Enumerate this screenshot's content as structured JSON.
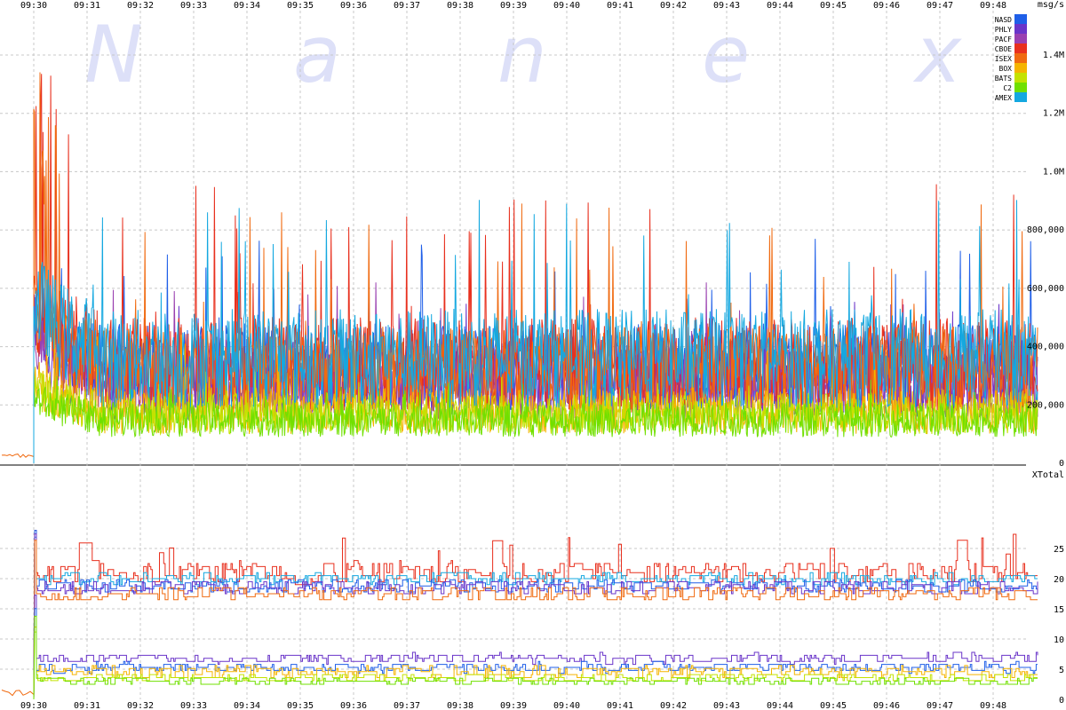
{
  "watermark": [
    "N",
    "a",
    "n",
    "e",
    "x"
  ],
  "chart_data": [
    {
      "type": "line",
      "title": "",
      "xlabel": "",
      "ylabel": "msg/s",
      "x_ticks": [
        "09:30",
        "09:31",
        "09:32",
        "09:33",
        "09:34",
        "09:35",
        "09:36",
        "09:37",
        "09:38",
        "09:39",
        "09:40",
        "09:41",
        "09:42",
        "09:43",
        "09:44",
        "09:45",
        "09:46",
        "09:47",
        "09:48"
      ],
      "y_ticks": [
        0,
        200000,
        400000,
        600000,
        800000,
        1000000,
        1200000,
        1400000
      ],
      "y_tick_labels": [
        "0",
        "200,000",
        "400,000",
        "600,000",
        "800,000",
        "1.0M",
        "1.2M",
        "1.4M"
      ],
      "ylim": [
        0,
        1500000
      ],
      "xlim": [
        "09:30",
        "09:48:50"
      ],
      "grid": true,
      "legend_position": "top-right",
      "series": [
        {
          "name": "NASD",
          "color": "#1f5fe8",
          "typical": 330000,
          "spread": 150000,
          "peak": 1150000
        },
        {
          "name": "PHLY",
          "color": "#6a35c9",
          "typical": 270000,
          "spread": 120000,
          "peak": 800000
        },
        {
          "name": "PACF",
          "color": "#9a40b0",
          "typical": 300000,
          "spread": 130000,
          "peak": 900000
        },
        {
          "name": "CBOE",
          "color": "#e8301e",
          "typical": 340000,
          "spread": 160000,
          "peak": 1470000
        },
        {
          "name": "ISEX",
          "color": "#f06a10",
          "typical": 320000,
          "spread": 150000,
          "peak": 1360000
        },
        {
          "name": "BOX",
          "color": "#f5b400",
          "typical": 180000,
          "spread": 80000,
          "peak": 700000
        },
        {
          "name": "BATS",
          "color": "#c4e200",
          "typical": 170000,
          "spread": 70000,
          "peak": 450000
        },
        {
          "name": "C2",
          "color": "#70e000",
          "typical": 150000,
          "spread": 60000,
          "peak": 400000
        },
        {
          "name": "AMEX",
          "color": "#14a8e0",
          "typical": 360000,
          "spread": 170000,
          "peak": 1350000
        }
      ]
    },
    {
      "type": "line",
      "title": "",
      "xlabel": "",
      "ylabel": "XTotal",
      "x_ticks": [
        "09:30",
        "09:31",
        "09:32",
        "09:33",
        "09:34",
        "09:35",
        "09:36",
        "09:37",
        "09:38",
        "09:39",
        "09:40",
        "09:41",
        "09:42",
        "09:43",
        "09:44",
        "09:45",
        "09:46",
        "09:47",
        "09:48"
      ],
      "y_ticks": [
        0,
        5,
        10,
        15,
        20,
        25
      ],
      "y_tick_labels": [
        "0",
        "5",
        "10",
        "15",
        "20",
        "25"
      ],
      "ylim": [
        0,
        29
      ],
      "grid": true,
      "series": [
        {
          "color": "#e8301e",
          "level": 21,
          "spread": 1.8
        },
        {
          "color": "#14a8e0",
          "level": 20,
          "spread": 1.0
        },
        {
          "color": "#1f5fe8",
          "level": 18.8,
          "spread": 1.0
        },
        {
          "color": "#6a35c9",
          "level": 18.5,
          "spread": 1.2
        },
        {
          "color": "#f06a10",
          "level": 17.5,
          "spread": 1.2
        },
        {
          "color": "#6a35c9",
          "level": 6.8,
          "spread": 0.8
        },
        {
          "color": "#1f5fe8",
          "level": 5.3,
          "spread": 0.8
        },
        {
          "color": "#f5b400",
          "level": 4.6,
          "spread": 1.0
        },
        {
          "color": "#c4e200",
          "level": 3.6,
          "spread": 0.7
        },
        {
          "color": "#70e000",
          "level": 3.0,
          "spread": 0.5
        }
      ]
    }
  ]
}
